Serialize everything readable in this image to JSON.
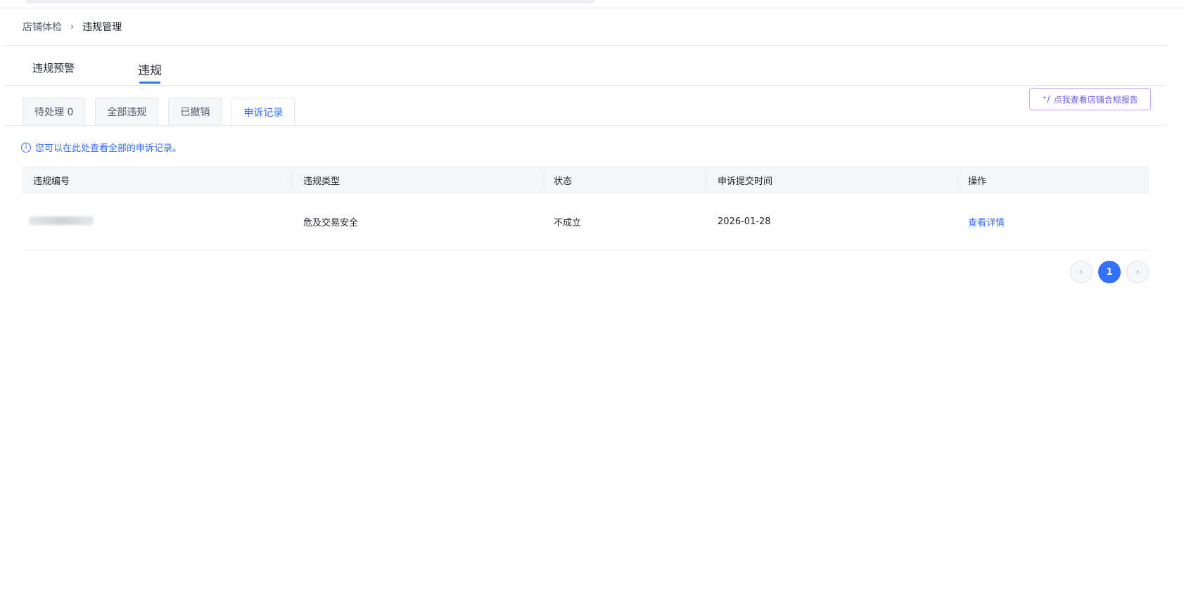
{
  "breadcrumb": {
    "parent": "店铺体检",
    "separator": "›",
    "current": "违规管理"
  },
  "main_tabs": [
    {
      "label": "违规预警",
      "active": false
    },
    {
      "label": "违规",
      "active": true
    }
  ],
  "sub_tabs": [
    {
      "label": "待处理 0",
      "active": false
    },
    {
      "label": "全部违规",
      "active": false
    },
    {
      "label": "已撤销",
      "active": false
    },
    {
      "label": "申诉记录",
      "active": true
    }
  ],
  "report_button": {
    "icon": "sparkle-icon",
    "label": "点我查看店铺合规报告"
  },
  "notice": {
    "icon": "info-icon",
    "text": "您可以在此处查看全部的申诉记录。"
  },
  "table": {
    "columns": [
      "违规编号",
      "违规类型",
      "状态",
      "申诉提交时间",
      "操作"
    ],
    "rows": [
      {
        "type": "危及交易安全",
        "status": "不成立",
        "submit_time": "2026-01-28",
        "action": "查看详情"
      }
    ]
  },
  "pagination": {
    "prev": "‹",
    "current_page": "1",
    "next": "›"
  },
  "colors": {
    "accent": "#3370ff",
    "report_border": "#c7a8f5",
    "report_text": "#6b5ae0"
  }
}
